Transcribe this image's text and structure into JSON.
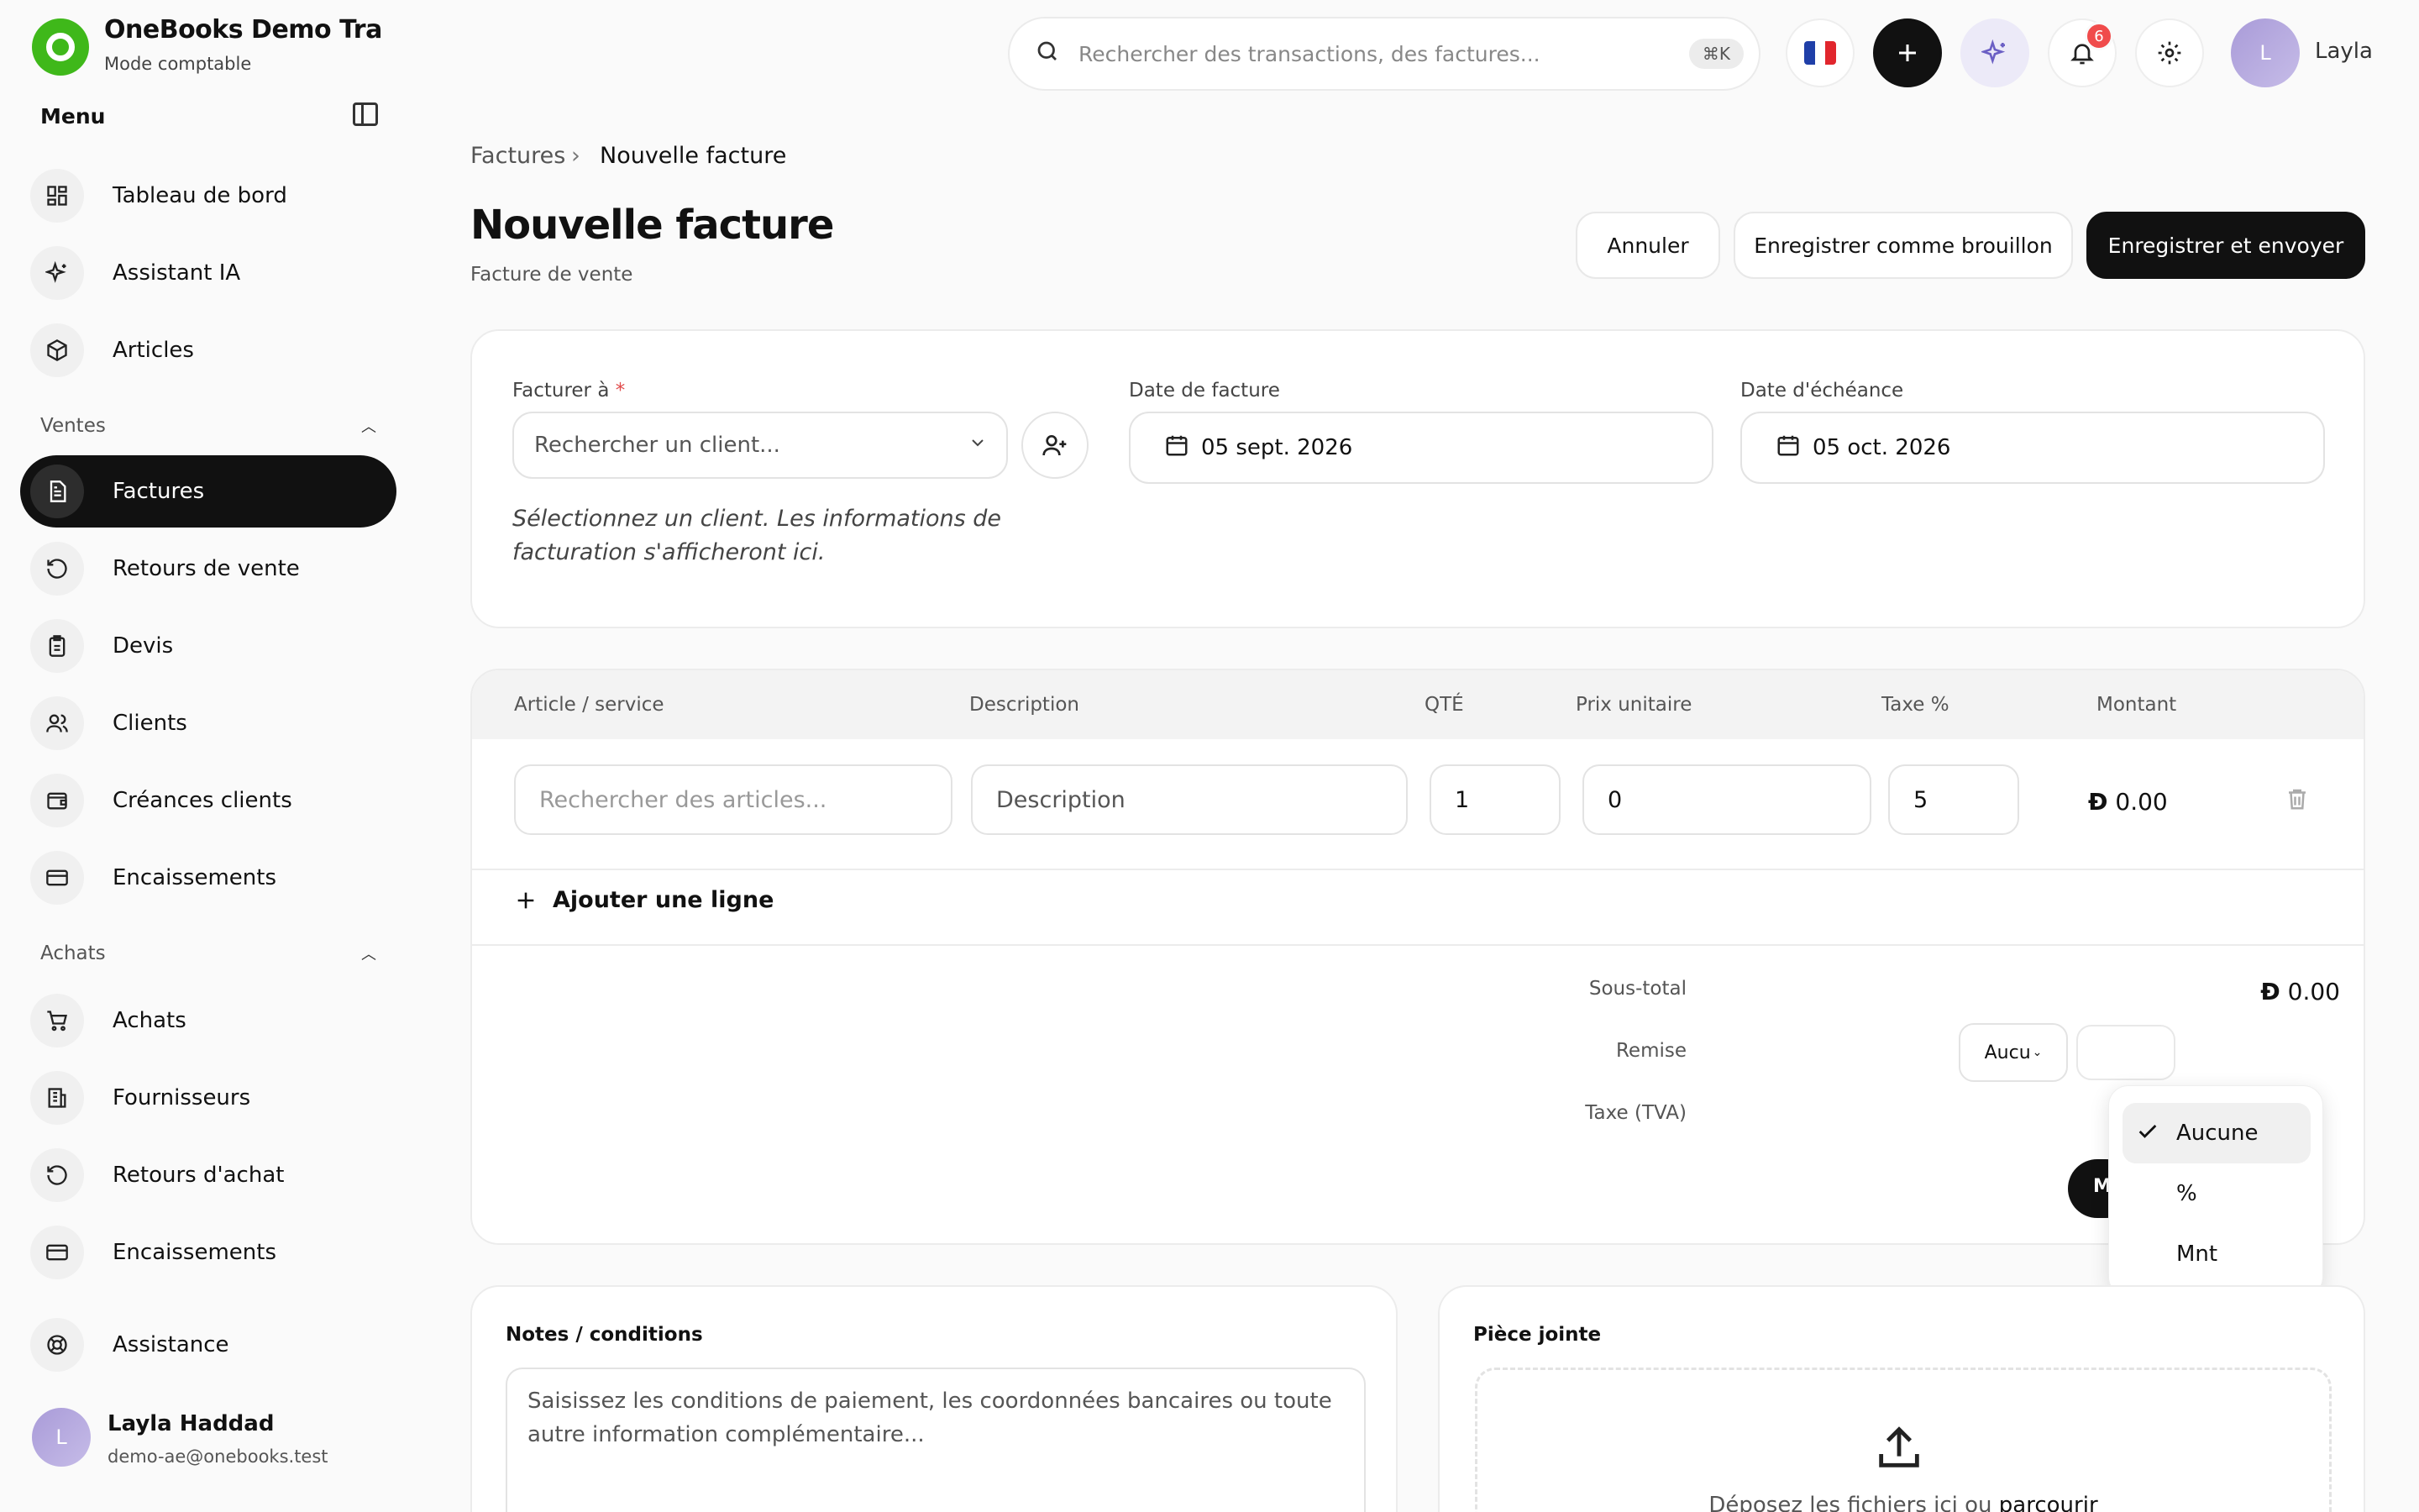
{
  "brand": {
    "name": "OneBooks Demo Tradin...",
    "mode": "Mode comptable"
  },
  "sidebar": {
    "menu_title": "Menu",
    "items_top": [
      {
        "label": "Tableau de bord",
        "icon": "dashboard-icon"
      },
      {
        "label": "Assistant IA",
        "icon": "sparkles-icon"
      },
      {
        "label": "Articles",
        "icon": "box-icon"
      }
    ],
    "ventes_title": "Ventes",
    "ventes_items": [
      {
        "label": "Factures",
        "icon": "invoice-icon",
        "active": true
      },
      {
        "label": "Retours de vente",
        "icon": "return-icon"
      },
      {
        "label": "Devis",
        "icon": "clipboard-icon"
      },
      {
        "label": "Clients",
        "icon": "users-icon"
      },
      {
        "label": "Créances clients",
        "icon": "wallet-icon"
      },
      {
        "label": "Encaissements",
        "icon": "card-icon"
      }
    ],
    "achats_title": "Achats",
    "achats_items": [
      {
        "label": "Achats",
        "icon": "cart-icon"
      },
      {
        "label": "Fournisseurs",
        "icon": "building-icon"
      },
      {
        "label": "Retours d'achat",
        "icon": "return-icon"
      },
      {
        "label": "Encaissements",
        "icon": "card-icon"
      }
    ],
    "support": {
      "label": "Assistance",
      "icon": "lifebuoy-icon"
    },
    "user": {
      "initial": "L",
      "name": "Layla Haddad",
      "email": "demo-ae@onebooks.test"
    }
  },
  "header": {
    "search_placeholder": "Rechercher des transactions, des factures...",
    "shortcut": "⌘K",
    "notifications_count": "6",
    "avatar_initial": "L",
    "username": "Layla"
  },
  "breadcrumb": {
    "parent": "Factures",
    "current": "Nouvelle facture"
  },
  "page": {
    "title": "Nouvelle facture",
    "subtitle": "Facture de vente"
  },
  "actions": {
    "cancel": "Annuler",
    "draft": "Enregistrer comme brouillon",
    "send": "Enregistrer et envoyer"
  },
  "form": {
    "bill_to_label": "Facturer à",
    "required_mark": "*",
    "client_placeholder": "Rechercher un client...",
    "client_hint": "Sélectionnez un client. Les informations de facturation s'afficheront ici.",
    "invoice_date_label": "Date de facture",
    "invoice_date": "05 sept. 2026",
    "due_date_label": "Date d'échéance",
    "due_date": "05 oct. 2026"
  },
  "items": {
    "headers": [
      "Article / service",
      "Description",
      "QTÉ",
      "Prix unitaire",
      "Taxe %",
      "Montant"
    ],
    "row": {
      "article_placeholder": "Rechercher des articles...",
      "description_placeholder": "Description",
      "qty": "1",
      "unit_price": "0",
      "tax": "5",
      "amount": "0.00",
      "currency_symbol": "Ð"
    },
    "add_line": "Ajouter une ligne"
  },
  "totals": {
    "subtotal_label": "Sous-total",
    "subtotal_value": "0.00",
    "discount_label": "Remise",
    "discount_type": "Aucu",
    "tax_label": "Taxe (TVA)",
    "hidden_button_text": "M"
  },
  "discount_dropdown": {
    "options": [
      "Aucune",
      "%",
      "Mnt"
    ],
    "selected": "Aucune"
  },
  "notes": {
    "title": "Notes / conditions",
    "placeholder": "Saisissez les conditions de paiement, les coordonnées bancaires ou toute autre information complémentaire..."
  },
  "attachment": {
    "title": "Pièce jointe",
    "drop_text": "Déposez les fichiers ici ou",
    "browse": "parcourir"
  }
}
